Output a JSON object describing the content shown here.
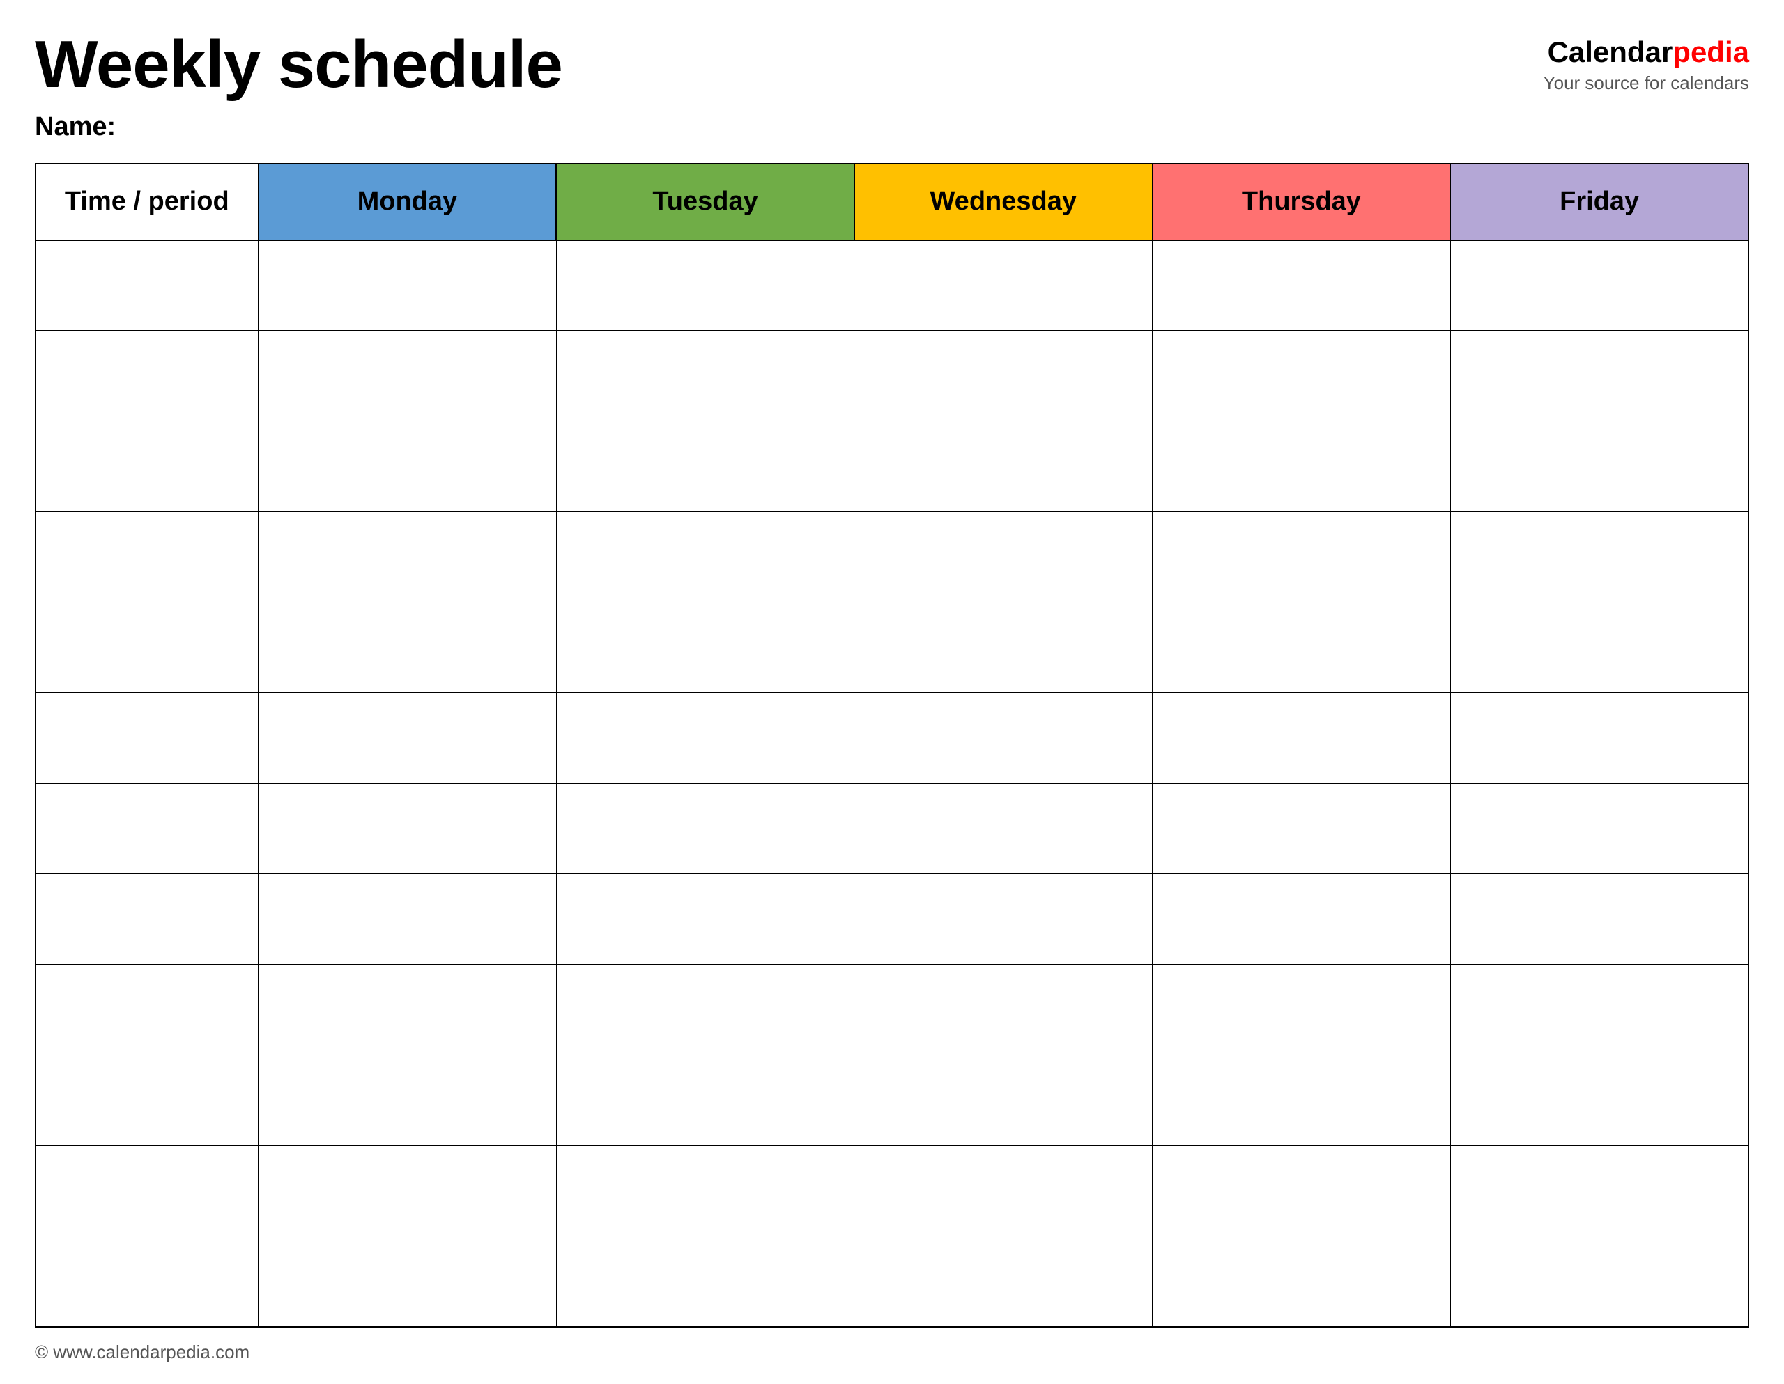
{
  "header": {
    "title": "Weekly schedule",
    "name_label": "Name:",
    "logo_text_calendar": "Calendar",
    "logo_text_pedia": "pedia",
    "logo_tagline": "Your source for calendars"
  },
  "table": {
    "columns": [
      {
        "key": "time",
        "label": "Time / period",
        "class": "th-time"
      },
      {
        "key": "monday",
        "label": "Monday",
        "class": "th-monday"
      },
      {
        "key": "tuesday",
        "label": "Tuesday",
        "class": "th-tuesday"
      },
      {
        "key": "wednesday",
        "label": "Wednesday",
        "class": "th-wednesday"
      },
      {
        "key": "thursday",
        "label": "Thursday",
        "class": "th-thursday"
      },
      {
        "key": "friday",
        "label": "Friday",
        "class": "th-friday"
      }
    ],
    "row_count": 12
  },
  "footer": {
    "url": "© www.calendarpedia.com"
  }
}
